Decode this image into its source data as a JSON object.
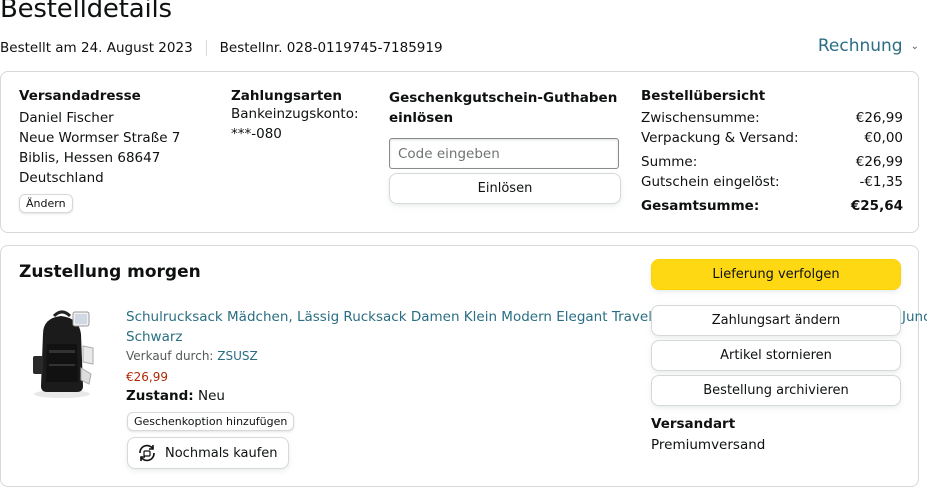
{
  "header": {
    "title": "Bestelldetails",
    "ordered_on": "Bestellt am 24. August 2023",
    "order_number": "Bestellnr. 028-0119745-7185919",
    "invoice_label": "Rechnung"
  },
  "shipping_address": {
    "heading": "Versandadresse",
    "name": "Daniel Fischer",
    "street": "Neue Wormser Straße 7",
    "city": "Biblis, Hessen 68647",
    "country": "Deutschland",
    "change_label": "Ändern"
  },
  "payment": {
    "heading": "Zahlungsarten",
    "method": "Bankeinzugskonto:",
    "account": "***-080"
  },
  "gift_card": {
    "heading": "Geschenkgutschein-Guthaben einlösen",
    "placeholder": "Code eingeben",
    "redeem_label": "Einlösen"
  },
  "order_summary": {
    "heading": "Bestellübersicht",
    "rows": [
      {
        "label": "Zwischensumme:",
        "value": "€26,99"
      },
      {
        "label": "Verpackung & Versand:",
        "value": "€0,00"
      },
      {
        "label": "Summe:",
        "value": "€26,99"
      },
      {
        "label": "Gutschein eingelöst:",
        "value": "-€1,35"
      }
    ],
    "total_label": "Gesamtsumme:",
    "total_value": "€25,64"
  },
  "shipment": {
    "title": "Zustellung morgen",
    "product": {
      "title": "Schulrucksack Mädchen, Lässig Rucksack Damen Klein Modern Elegant Travelite Le… Jungen Schwarz",
      "title_line1": "Schulrucksack Mädchen, Lässig Rucksack Damen Klein Modern Elegant Travelite Le",
      "title_tail": "Junc",
      "title_line2": "Schwarz",
      "sold_by_label": "Verkauf durch:",
      "seller": "ZSUSZ",
      "price": "€26,99",
      "condition_label": "Zustand:",
      "condition_value": "Neu",
      "gift_option_label": "Geschenkoption hinzufügen",
      "buy_again_label": "Nochmals kaufen"
    },
    "actions": {
      "track": "Lieferung verfolgen",
      "change_payment": "Zahlungsart ändern",
      "cancel": "Artikel stornieren",
      "archive": "Bestellung archivieren"
    },
    "shipping_method_heading": "Versandart",
    "shipping_method_value": "Premiumversand"
  },
  "colors": {
    "link": "#2a6e83",
    "price": "#b12704",
    "primary_button": "#ffd814",
    "border": "#d5d9d9"
  }
}
